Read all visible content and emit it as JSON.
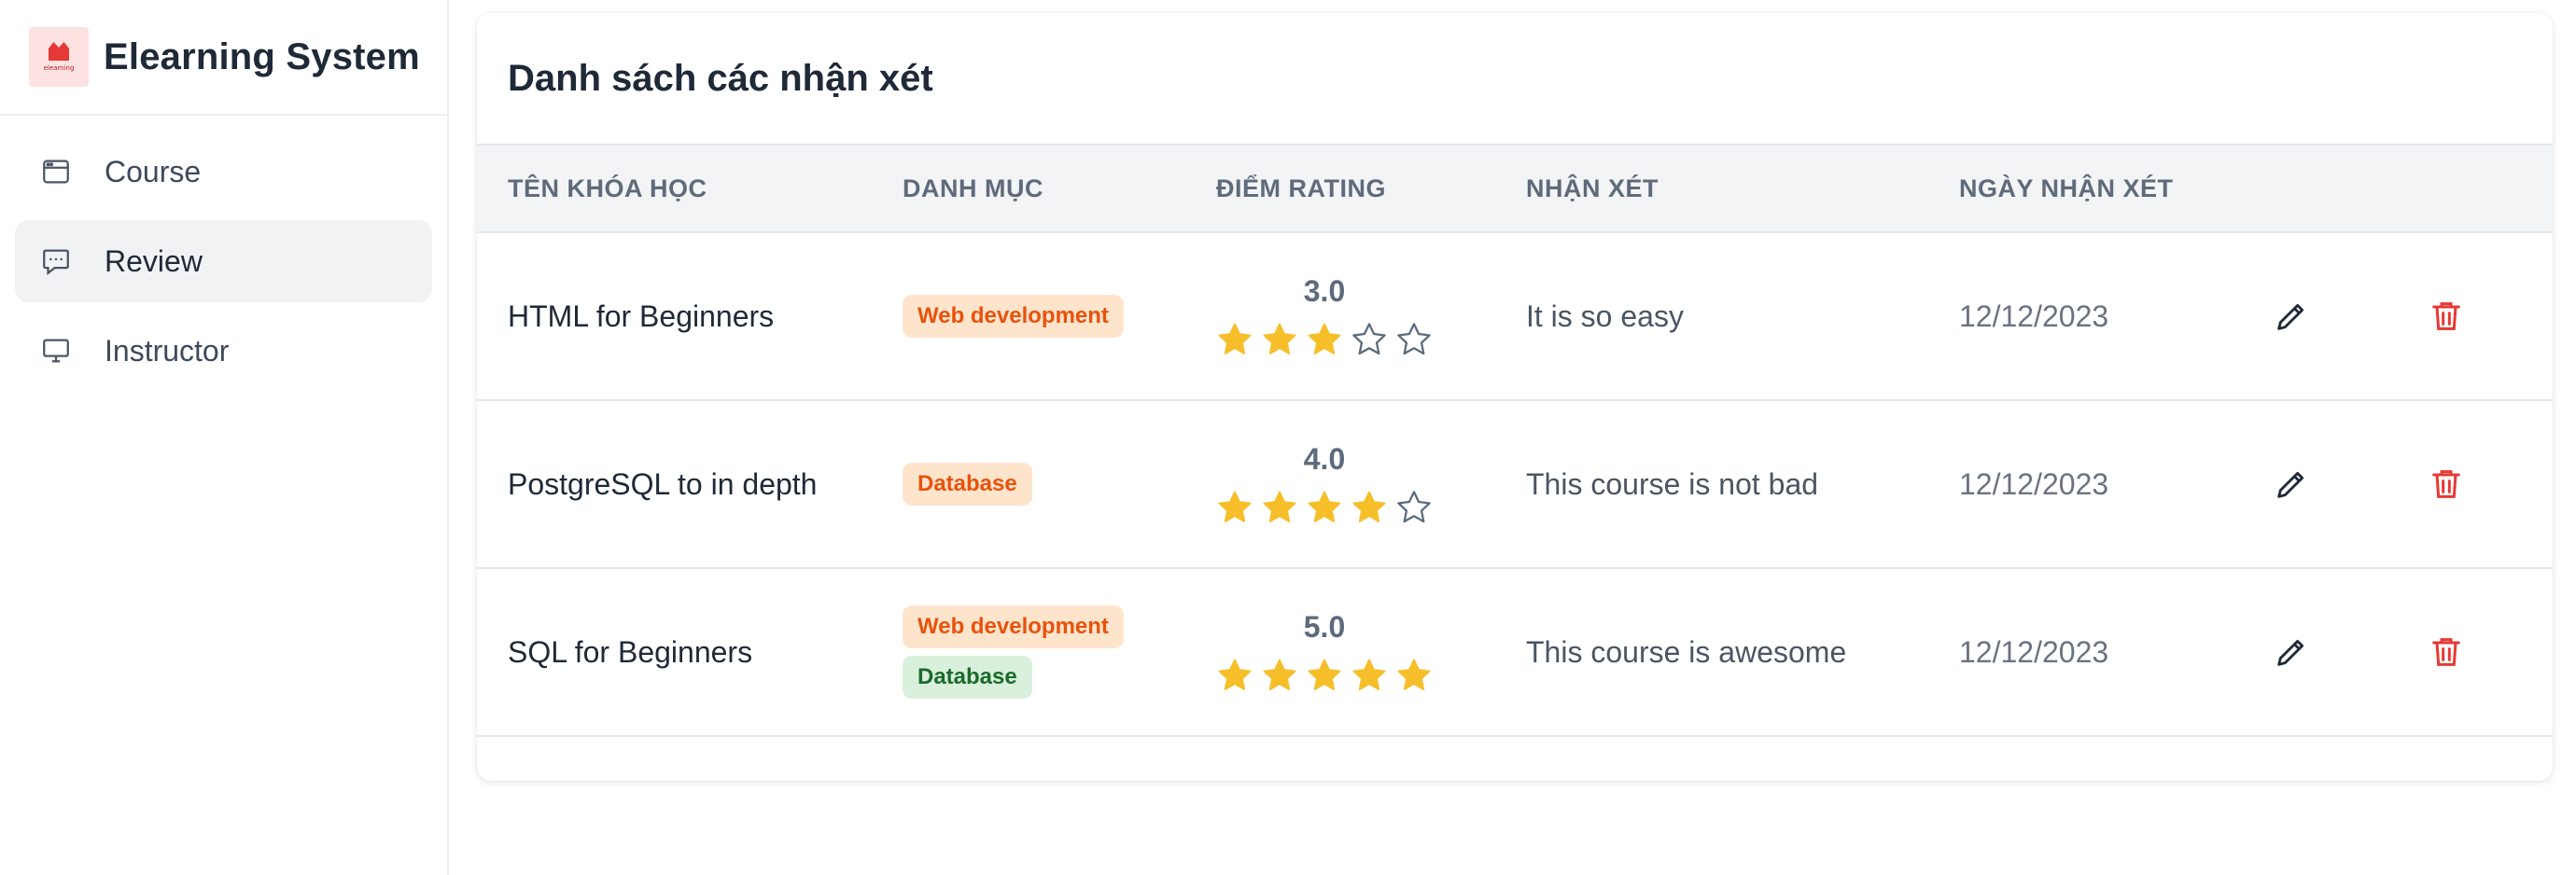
{
  "app": {
    "name": "Elearning System",
    "logo_text": "elearning"
  },
  "sidebar": {
    "items": [
      {
        "label": "Course",
        "icon": "window-icon",
        "active": false
      },
      {
        "label": "Review",
        "icon": "chat-icon",
        "active": true
      },
      {
        "label": "Instructor",
        "icon": "monitor-icon",
        "active": false
      }
    ]
  },
  "main": {
    "title": "Danh sách các nhận xét",
    "table": {
      "headers": [
        "TÊN KHÓA HỌC",
        "DANH MỤC",
        "ĐIỂM RATING",
        "NHẬN XÉT",
        "NGÀY NHẬN XÉT"
      ],
      "rows": [
        {
          "course": "HTML for Beginners",
          "categories": [
            {
              "label": "Web development",
              "color": "orange"
            }
          ],
          "score": "3.0",
          "stars": 3,
          "comment": "It is so easy",
          "date": "12/12/2023"
        },
        {
          "course": "PostgreSQL to in depth",
          "categories": [
            {
              "label": "Database",
              "color": "orange"
            }
          ],
          "score": "4.0",
          "stars": 4,
          "comment": "This course is not bad",
          "date": "12/12/2023"
        },
        {
          "course": "SQL for Beginners",
          "categories": [
            {
              "label": "Web development",
              "color": "orange"
            },
            {
              "label": "Database",
              "color": "green"
            }
          ],
          "score": "5.0",
          "stars": 5,
          "comment": "This course is awesome",
          "date": "12/12/2023"
        }
      ]
    }
  },
  "colors": {
    "star_filled": "#f6bf2a",
    "star_empty": "#5b6b7b",
    "delete": "#e53935",
    "badge_orange_bg": "#ffe4cc",
    "badge_orange_text": "#e8520c",
    "badge_green_bg": "#d9f0dc",
    "badge_green_text": "#1b6b2a"
  }
}
